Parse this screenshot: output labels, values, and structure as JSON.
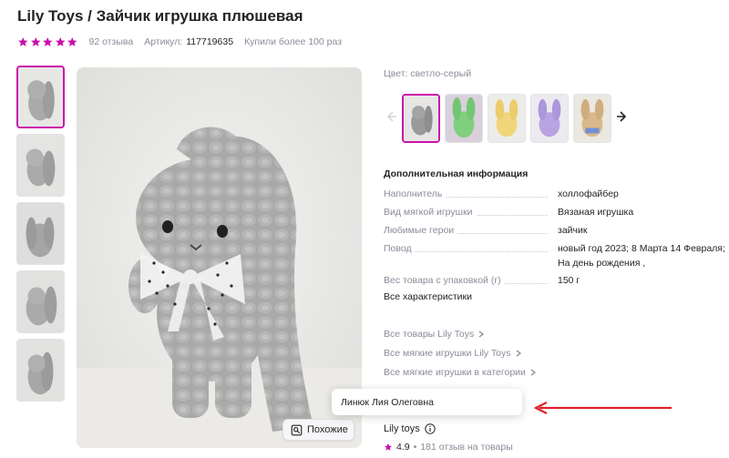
{
  "product": {
    "brand": "Lily Toys",
    "separator": " / ",
    "name": "Зайчик игрушка плюшевая",
    "reviews": "92 отзыва",
    "article_label": "Артикул:",
    "article_value": "117719635",
    "bought": "Купили более 100 раз",
    "rating_stars": 5
  },
  "gallery": {
    "similar_label": "Похожие",
    "thumb_icons": [
      "bunny-photo",
      "bunny-photo",
      "bunny-photo",
      "bunny-photo",
      "bunny-photo"
    ]
  },
  "color": {
    "label": "Цвет:",
    "value": "светло-серый",
    "variants": [
      {
        "icon": "bunny-gray",
        "hex": "#9a9a9a"
      },
      {
        "icon": "bunny-green",
        "hex": "#7fcf7f"
      },
      {
        "icon": "bunny-yellow",
        "hex": "#f1d57a"
      },
      {
        "icon": "bunny-lilac",
        "hex": "#b9a3e3"
      },
      {
        "icon": "bunny-beige",
        "hex": "#d9b98b"
      }
    ]
  },
  "info": {
    "heading": "Дополнительная информация",
    "specs": [
      {
        "key": "Наполнитель",
        "value": "холлофайбер"
      },
      {
        "key": "Вид мягкой игрушки",
        "value": "Вязаная игрушка"
      },
      {
        "key": "Любимые герои",
        "value": "зайчик"
      },
      {
        "key": "Повод",
        "value": "новый год 2023; 8 Марта 14 Февраля; На день рождения ,"
      },
      {
        "key": "Вес товара с упаковкой (г)",
        "value": "150 г"
      }
    ],
    "all_specs": "Все характеристики"
  },
  "links": [
    "Все товары Lily Toys",
    "Все мягкие игрушки Lily Toys",
    "Все мягкие игрушки в категории"
  ],
  "popup": {
    "text": "Линюк Лия Олеговна"
  },
  "seller": {
    "name": "Lily toys",
    "rating": "4.9",
    "dot": "•",
    "reviews": "181 отзыв на товары"
  },
  "colors": {
    "accent": "#cb11ab",
    "annotation_arrow": "#e0202a",
    "muted": "#8b8b99",
    "text": "#242424"
  }
}
